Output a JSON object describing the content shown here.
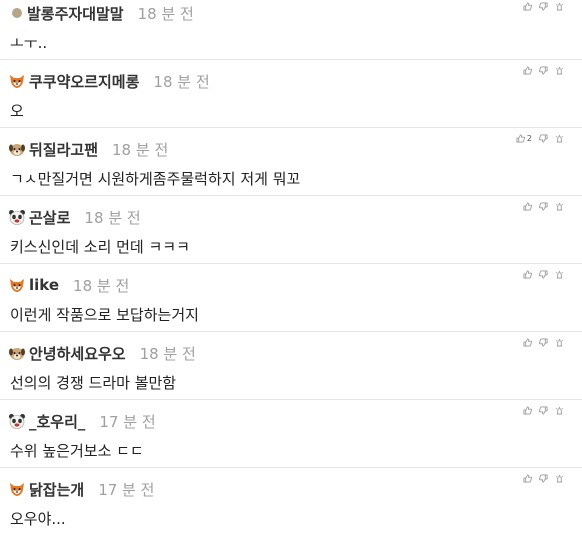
{
  "comments": [
    {
      "nickname": "발롱주자대말말",
      "time": "18 분 전",
      "text": "ㅗㅜ..",
      "avatar": "grade-dot-icon",
      "likes": ""
    },
    {
      "nickname": "쿠쿠약오르지메롱",
      "time": "18 분 전",
      "text": "오",
      "avatar": "fox-grade-icon",
      "likes": ""
    },
    {
      "nickname": "뒤질라고팬",
      "time": "18 분 전",
      "text": "ㄱㅅ만질거면 시원하게좀주물럭하지 저게 뭐꼬",
      "avatar": "dog-grade-icon",
      "likes": "2"
    },
    {
      "nickname": "곤살로",
      "time": "18 분 전",
      "text": "키스신인데 소리 먼데 ㅋㅋㅋ",
      "avatar": "panda-grade-icon",
      "likes": ""
    },
    {
      "nickname": "like",
      "time": "18 분 전",
      "text": "이런게 작품으로 보답하는거지",
      "avatar": "fox-grade-icon",
      "likes": ""
    },
    {
      "nickname": "안녕하세요우오",
      "time": "18 분 전",
      "text": "선의의 경쟁 드라마 볼만함",
      "avatar": "dog-grade-icon",
      "likes": ""
    },
    {
      "nickname": "_호우리_",
      "time": "17 분 전",
      "text": "수위 높은거보소 ㄷㄷ",
      "avatar": "panda-grade-icon",
      "likes": ""
    },
    {
      "nickname": "닭잡는개",
      "time": "17 분 전",
      "text": "오우야...",
      "avatar": "fox-grade-icon",
      "likes": ""
    }
  ],
  "colors": {
    "nickname": "#333333",
    "time": "#a0a0a0",
    "text": "#222222",
    "divider": "#e6e6e6",
    "icon": "#9a9a9a"
  }
}
